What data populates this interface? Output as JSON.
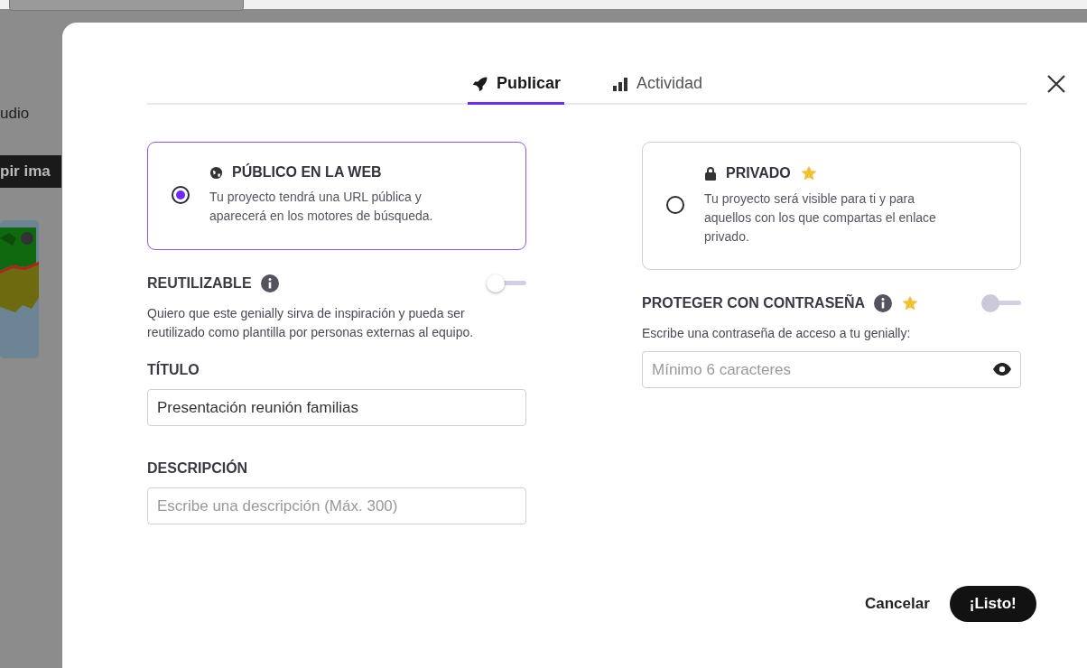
{
  "background": {
    "tab_label": "udio",
    "button_label": "pir ima"
  },
  "dialog": {
    "tabs": [
      {
        "label": "Publicar",
        "selected": true
      },
      {
        "label": "Actividad",
        "selected": false
      }
    ],
    "visibility_options": [
      {
        "title": "PÚBLICO EN LA WEB",
        "description": "Tu proyecto tendrá una URL pública y aparecerá en los motores de búsqueda.",
        "selected": true,
        "premium": false
      },
      {
        "title": "PRIVADO",
        "description": "Tu proyecto será visible para ti y para aquellos con los que compartas el enlace privado.",
        "selected": false,
        "premium": true
      }
    ],
    "reusable": {
      "label": "REUTILIZABLE",
      "on": false,
      "disabled": false,
      "description": "Quiero que este genially sirva de inspiración y pueda ser reutilizado como plantilla por personas externas al equipo."
    },
    "title_field": {
      "label": "TÍTULO",
      "value": "Presentación reunión familias"
    },
    "description_field": {
      "label": "DESCRIPCIÓN",
      "placeholder": "Escribe una descripción (Máx. 300)"
    },
    "password": {
      "label": "PROTEGER CON CONTRASEÑA",
      "premium": true,
      "on": false,
      "disabled": true,
      "hint": "Escribe una contraseña de acceso a tu genially:",
      "placeholder": "Mínimo 6 caracteres"
    },
    "buttons": [
      {
        "label": "Cancelar",
        "kind": "secondary"
      },
      {
        "label": "¡Listo!",
        "kind": "primary"
      }
    ]
  }
}
